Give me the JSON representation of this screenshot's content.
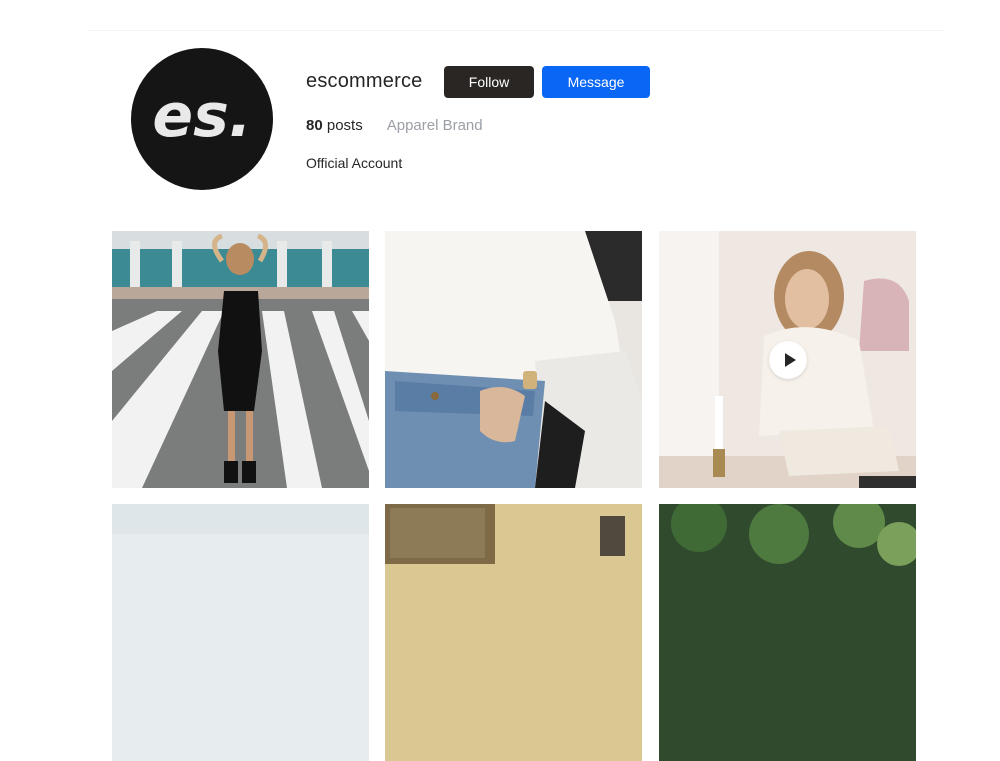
{
  "profile": {
    "username": "escommerce",
    "avatar_text": "es.",
    "follow_label": "Follow",
    "message_label": "Message",
    "posts_count": "80",
    "posts_label": "posts",
    "category": "Apparel Brand",
    "bio": "Official Account"
  },
  "colors": {
    "follow_button": "#2a2624",
    "message_button": "#0a66f5",
    "avatar_bg": "#151515"
  },
  "posts": [
    {
      "type": "image",
      "icon": "photo"
    },
    {
      "type": "image",
      "icon": "photo"
    },
    {
      "type": "video",
      "icon": "play-icon"
    },
    {
      "type": "image",
      "icon": "photo"
    },
    {
      "type": "image",
      "icon": "photo"
    },
    {
      "type": "image",
      "icon": "photo"
    }
  ]
}
